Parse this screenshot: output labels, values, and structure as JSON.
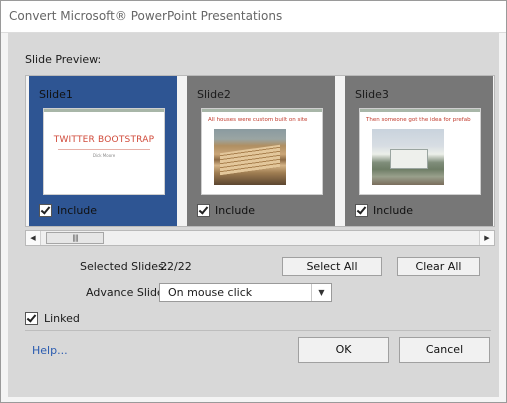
{
  "window": {
    "title": "Convert Microsoft® PowerPoint Presentations"
  },
  "preview": {
    "label": "Slide Preview:"
  },
  "slides": [
    {
      "title": "Slide1",
      "include_label": "Include",
      "included": true,
      "selected": true,
      "thumb_heading": "TWITTER BOOTSTRAP",
      "thumb_sub": "Dick Moore"
    },
    {
      "title": "Slide2",
      "include_label": "Include",
      "included": true,
      "selected": false,
      "thumb_text": "All houses were custom built on site"
    },
    {
      "title": "Slide3",
      "include_label": "Include",
      "included": true,
      "selected": false,
      "thumb_text": "Then someone got the idea for prefab"
    }
  ],
  "scrollbar": {
    "left_arrow": "◀",
    "right_arrow": "▶",
    "grip": "||||"
  },
  "selected_slides": {
    "label": "Selected Slides:",
    "value": "22/22"
  },
  "buttons": {
    "select_all": "Select All",
    "clear_all": "Clear All",
    "ok": "OK",
    "cancel": "Cancel"
  },
  "advance_slide": {
    "label": "Advance Slide:",
    "value": "On mouse click",
    "dropdown_glyph": "▼"
  },
  "linked": {
    "label": "Linked",
    "checked": true
  },
  "help": {
    "label": "Help..."
  },
  "colors": {
    "selected_slide": "#2e5593",
    "unselected_slide": "#777777",
    "link": "#2a5bb0"
  }
}
